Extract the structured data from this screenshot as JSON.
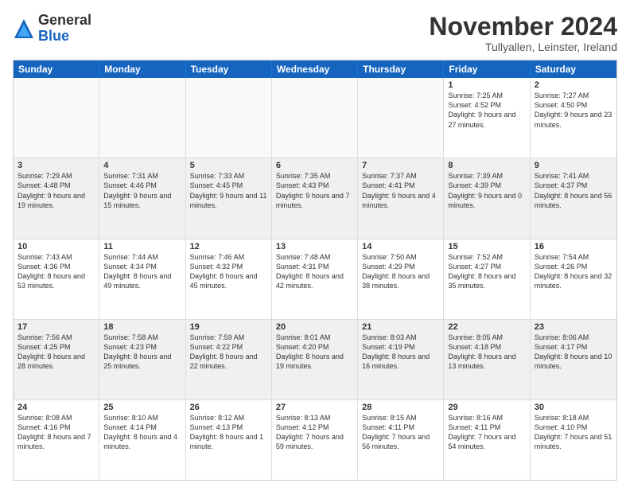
{
  "header": {
    "logo_general": "General",
    "logo_blue": "Blue",
    "month_title": "November 2024",
    "subtitle": "Tullyallen, Leinster, Ireland"
  },
  "weekdays": [
    "Sunday",
    "Monday",
    "Tuesday",
    "Wednesday",
    "Thursday",
    "Friday",
    "Saturday"
  ],
  "rows": [
    [
      {
        "day": "",
        "info": ""
      },
      {
        "day": "",
        "info": ""
      },
      {
        "day": "",
        "info": ""
      },
      {
        "day": "",
        "info": ""
      },
      {
        "day": "",
        "info": ""
      },
      {
        "day": "1",
        "info": "Sunrise: 7:25 AM\nSunset: 4:52 PM\nDaylight: 9 hours\nand 27 minutes."
      },
      {
        "day": "2",
        "info": "Sunrise: 7:27 AM\nSunset: 4:50 PM\nDaylight: 9 hours\nand 23 minutes."
      }
    ],
    [
      {
        "day": "3",
        "info": "Sunrise: 7:29 AM\nSunset: 4:48 PM\nDaylight: 9 hours\nand 19 minutes."
      },
      {
        "day": "4",
        "info": "Sunrise: 7:31 AM\nSunset: 4:46 PM\nDaylight: 9 hours\nand 15 minutes."
      },
      {
        "day": "5",
        "info": "Sunrise: 7:33 AM\nSunset: 4:45 PM\nDaylight: 9 hours\nand 11 minutes."
      },
      {
        "day": "6",
        "info": "Sunrise: 7:35 AM\nSunset: 4:43 PM\nDaylight: 9 hours\nand 7 minutes."
      },
      {
        "day": "7",
        "info": "Sunrise: 7:37 AM\nSunset: 4:41 PM\nDaylight: 9 hours\nand 4 minutes."
      },
      {
        "day": "8",
        "info": "Sunrise: 7:39 AM\nSunset: 4:39 PM\nDaylight: 9 hours\nand 0 minutes."
      },
      {
        "day": "9",
        "info": "Sunrise: 7:41 AM\nSunset: 4:37 PM\nDaylight: 8 hours\nand 56 minutes."
      }
    ],
    [
      {
        "day": "10",
        "info": "Sunrise: 7:43 AM\nSunset: 4:36 PM\nDaylight: 8 hours\nand 53 minutes."
      },
      {
        "day": "11",
        "info": "Sunrise: 7:44 AM\nSunset: 4:34 PM\nDaylight: 8 hours\nand 49 minutes."
      },
      {
        "day": "12",
        "info": "Sunrise: 7:46 AM\nSunset: 4:32 PM\nDaylight: 8 hours\nand 45 minutes."
      },
      {
        "day": "13",
        "info": "Sunrise: 7:48 AM\nSunset: 4:31 PM\nDaylight: 8 hours\nand 42 minutes."
      },
      {
        "day": "14",
        "info": "Sunrise: 7:50 AM\nSunset: 4:29 PM\nDaylight: 8 hours\nand 38 minutes."
      },
      {
        "day": "15",
        "info": "Sunrise: 7:52 AM\nSunset: 4:27 PM\nDaylight: 8 hours\nand 35 minutes."
      },
      {
        "day": "16",
        "info": "Sunrise: 7:54 AM\nSunset: 4:26 PM\nDaylight: 8 hours\nand 32 minutes."
      }
    ],
    [
      {
        "day": "17",
        "info": "Sunrise: 7:56 AM\nSunset: 4:25 PM\nDaylight: 8 hours\nand 28 minutes."
      },
      {
        "day": "18",
        "info": "Sunrise: 7:58 AM\nSunset: 4:23 PM\nDaylight: 8 hours\nand 25 minutes."
      },
      {
        "day": "19",
        "info": "Sunrise: 7:59 AM\nSunset: 4:22 PM\nDaylight: 8 hours\nand 22 minutes."
      },
      {
        "day": "20",
        "info": "Sunrise: 8:01 AM\nSunset: 4:20 PM\nDaylight: 8 hours\nand 19 minutes."
      },
      {
        "day": "21",
        "info": "Sunrise: 8:03 AM\nSunset: 4:19 PM\nDaylight: 8 hours\nand 16 minutes."
      },
      {
        "day": "22",
        "info": "Sunrise: 8:05 AM\nSunset: 4:18 PM\nDaylight: 8 hours\nand 13 minutes."
      },
      {
        "day": "23",
        "info": "Sunrise: 8:06 AM\nSunset: 4:17 PM\nDaylight: 8 hours\nand 10 minutes."
      }
    ],
    [
      {
        "day": "24",
        "info": "Sunrise: 8:08 AM\nSunset: 4:16 PM\nDaylight: 8 hours\nand 7 minutes."
      },
      {
        "day": "25",
        "info": "Sunrise: 8:10 AM\nSunset: 4:14 PM\nDaylight: 8 hours\nand 4 minutes."
      },
      {
        "day": "26",
        "info": "Sunrise: 8:12 AM\nSunset: 4:13 PM\nDaylight: 8 hours\nand 1 minute."
      },
      {
        "day": "27",
        "info": "Sunrise: 8:13 AM\nSunset: 4:12 PM\nDaylight: 7 hours\nand 59 minutes."
      },
      {
        "day": "28",
        "info": "Sunrise: 8:15 AM\nSunset: 4:11 PM\nDaylight: 7 hours\nand 56 minutes."
      },
      {
        "day": "29",
        "info": "Sunrise: 8:16 AM\nSunset: 4:11 PM\nDaylight: 7 hours\nand 54 minutes."
      },
      {
        "day": "30",
        "info": "Sunrise: 8:18 AM\nSunset: 4:10 PM\nDaylight: 7 hours\nand 51 minutes."
      }
    ]
  ]
}
